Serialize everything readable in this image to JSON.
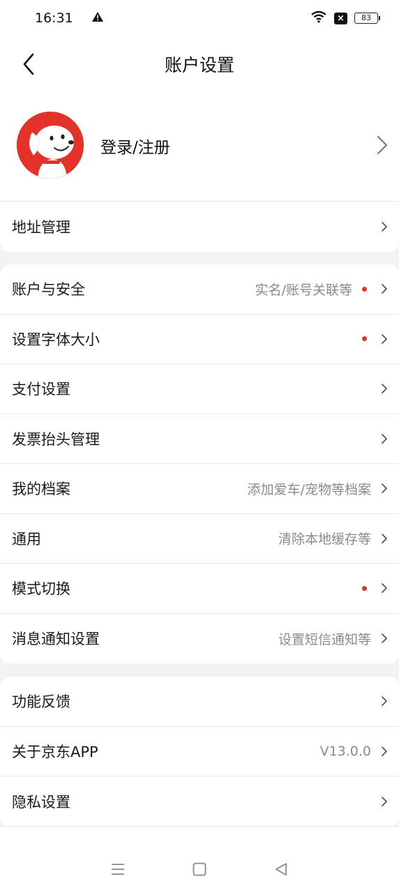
{
  "status_bar": {
    "time": "16:31",
    "battery": "83"
  },
  "header": {
    "title": "账户设置"
  },
  "profile": {
    "login_label": "登录/注册"
  },
  "section1": {
    "items": [
      {
        "label": "地址管理"
      }
    ]
  },
  "section2": {
    "items": [
      {
        "label": "账户与安全",
        "sub": "实名/账号关联等",
        "dot": true
      },
      {
        "label": "设置字体大小",
        "sub": "",
        "dot": true
      },
      {
        "label": "支付设置",
        "sub": "",
        "dot": false
      },
      {
        "label": "发票抬头管理",
        "sub": "",
        "dot": false
      },
      {
        "label": "我的档案",
        "sub": "添加爱车/宠物等档案",
        "dot": false
      },
      {
        "label": "通用",
        "sub": "清除本地缓存等",
        "dot": false
      },
      {
        "label": "模式切换",
        "sub": "",
        "dot": true
      },
      {
        "label": "消息通知设置",
        "sub": "设置短信通知等",
        "dot": false
      }
    ]
  },
  "section3": {
    "items": [
      {
        "label": "功能反馈",
        "sub": ""
      },
      {
        "label": "关于京东APP",
        "sub": "V13.0.0"
      },
      {
        "label": "隐私设置",
        "sub": ""
      }
    ]
  },
  "colors": {
    "accent": "#e4312a",
    "subtext": "#8a8a8a",
    "background": "#f3f3f3"
  },
  "icons": {
    "back": "chevron-left-icon",
    "row": "chevron-right-icon",
    "warning": "warning-icon",
    "wifi": "wifi-icon",
    "no_sim": "no-sim-icon",
    "battery": "battery-icon",
    "nav_menu": "menu-icon",
    "nav_home": "home-square-icon",
    "nav_back": "back-triangle-icon"
  }
}
